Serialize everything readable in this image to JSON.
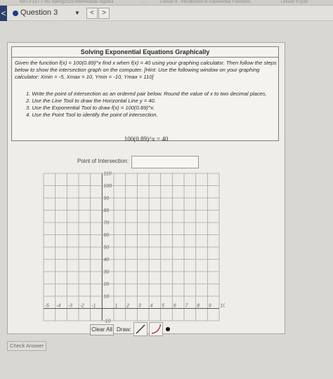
{
  "top_bar": {
    "course": "MAT-F137-TT91-Spring2023-Intermediate Algebra",
    "lesson": "Lesson 9 - Introduction to Exponential Functions",
    "quiz": "Lesson 9 Quiz",
    "ellipsis": "..."
  },
  "question_bar": {
    "label": "Question 3",
    "caret": "▼",
    "prev": "<",
    "next": ">",
    "back": "<"
  },
  "problem": {
    "title": "Solving Exponential Equations Graphically",
    "intro": "Given the function f(x) = 100(0.89)^x find x when f(x) = 40 using your graphing calculator. Then follow the steps below to show the intersection graph on the computer. [Hint: Use the following window on your graphing calculator: Xmin = -5, Xmax = 10, Ymin = -10, Ymax = 110]",
    "steps": [
      "1. Write the point of intersection as an ordered pair below. Round the value of x to two decimal places.",
      "2. Use the Line Tool to draw the Horizontal Line y = 40.",
      "3. Use the Exponential Tool to draw f(x) = 100(0.89)^x.",
      "4. Use the Point Tool to identify the point of intersection."
    ],
    "equation": "100(0.89)^x = 40"
  },
  "answer": {
    "label": "Point of Intersection:",
    "value": ""
  },
  "graph": {
    "y_ticks": [
      "110",
      "100",
      "90",
      "80",
      "70",
      "60",
      "50",
      "40",
      "30",
      "20",
      "10",
      "-10"
    ],
    "x_ticks": [
      "-5",
      "-4",
      "-3",
      "-2",
      "-1",
      "1",
      "2",
      "3",
      "4",
      "5",
      "6",
      "7",
      "8",
      "9",
      "10"
    ]
  },
  "toolbar": {
    "clear_label": "Clear All",
    "draw_label": "Draw:",
    "tools": [
      "line-tool",
      "exponential-tool",
      "point-tool"
    ]
  },
  "check_answer": "Check Answer",
  "colors": {
    "accent": "#1e3c8c",
    "curve_tool": "#b0303a"
  }
}
